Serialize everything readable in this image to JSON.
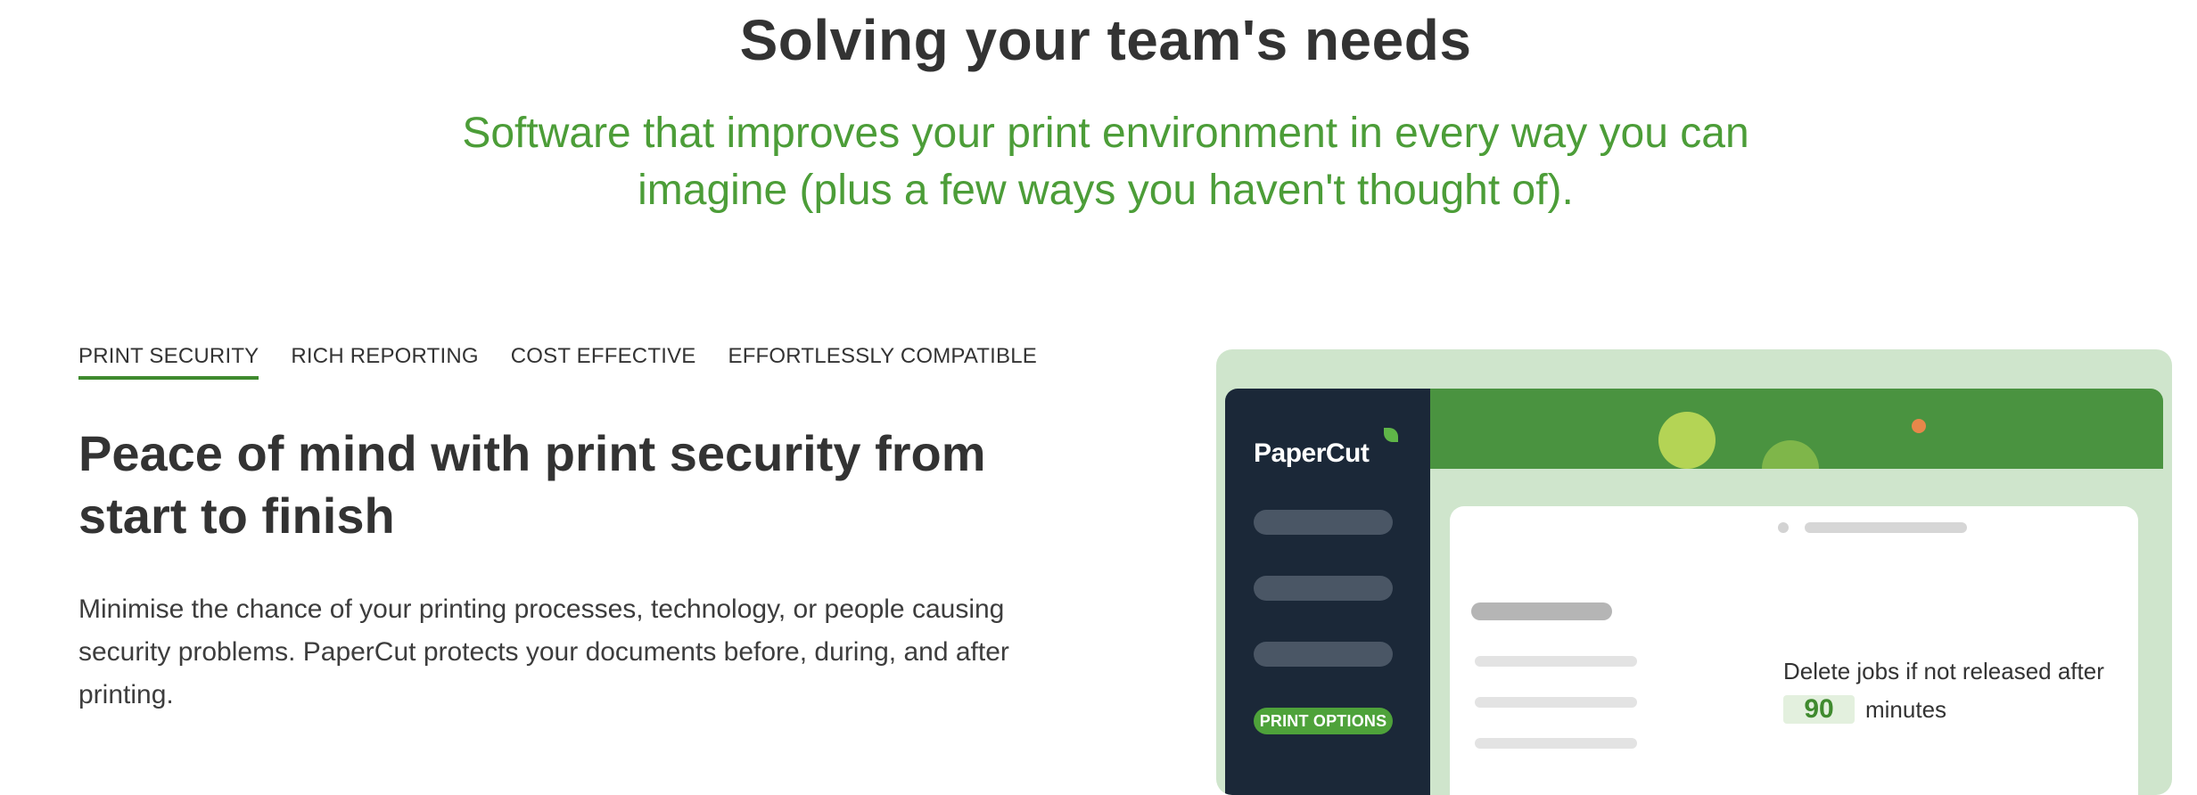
{
  "hero": {
    "title": "Solving your team's needs",
    "subtitle": "Software that improves your print environment in every way you can imagine (plus a few ways you haven't thought of)."
  },
  "tabs": [
    {
      "label": "PRINT SECURITY",
      "active": true
    },
    {
      "label": "RICH REPORTING",
      "active": false
    },
    {
      "label": "COST EFFECTIVE",
      "active": false
    },
    {
      "label": "EFFORTLESSLY COMPATIBLE",
      "active": false
    }
  ],
  "section": {
    "title": "Peace of mind with print security from start to finish",
    "body": "Minimise the chance of your printing processes, technology, or people causing security problems. PaperCut protects your documents before, during, and after printing."
  },
  "illustration": {
    "logo_text": "PaperCut",
    "print_options_label": "PRINT OPTIONS",
    "setting_label": "Delete jobs if not released after",
    "setting_value": "90",
    "setting_unit": "minutes"
  },
  "colors": {
    "accent_green": "#4c9d38",
    "sidebar_navy": "#1b2838",
    "topbar_green": "#4a9340",
    "panel_bg": "#cfe5cc"
  }
}
